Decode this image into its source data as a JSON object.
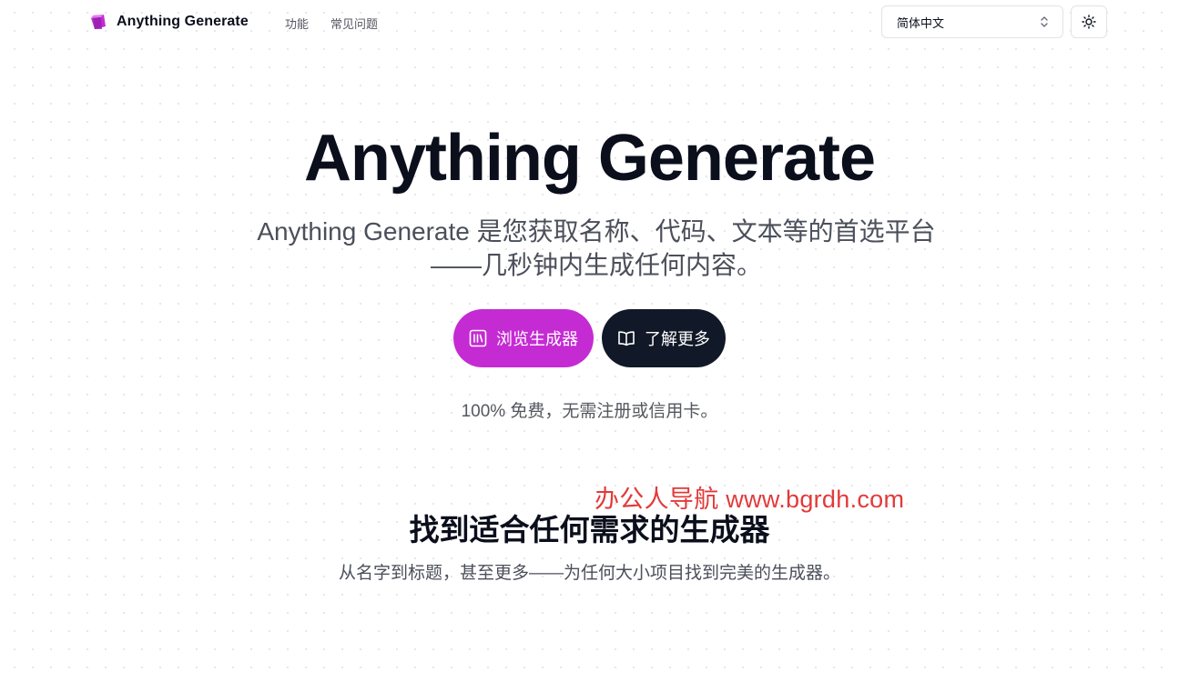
{
  "brand": {
    "name": "Anything Generate",
    "logo_icon": "cube-logo-icon",
    "accent": "#c42bd3"
  },
  "nav": {
    "items": [
      "功能",
      "常见问题"
    ]
  },
  "language_select": {
    "value": "简体中文",
    "icon": "chevron-up-down-icon"
  },
  "theme_toggle": {
    "icon": "sun-icon"
  },
  "hero": {
    "title": "Anything Generate",
    "subtitle": "Anything Generate 是您获取名称、代码、文本等的首选平台——几秒钟内生成任何内容。",
    "primary_button": {
      "label": "浏览生成器",
      "icon": "library-icon",
      "color": "#c42bd3"
    },
    "secondary_button": {
      "label": "了解更多",
      "icon": "book-open-icon",
      "color": "#111827"
    },
    "note": "100% 免费，无需注册或信用卡。"
  },
  "watermark": {
    "text": "办公人导航 www.bgrdh.com",
    "color": "#e23a3a"
  },
  "section": {
    "title": "找到适合任何需求的生成器",
    "subtitle": "从名字到标题，甚至更多——为任何大小项目找到完美的生成器。"
  }
}
